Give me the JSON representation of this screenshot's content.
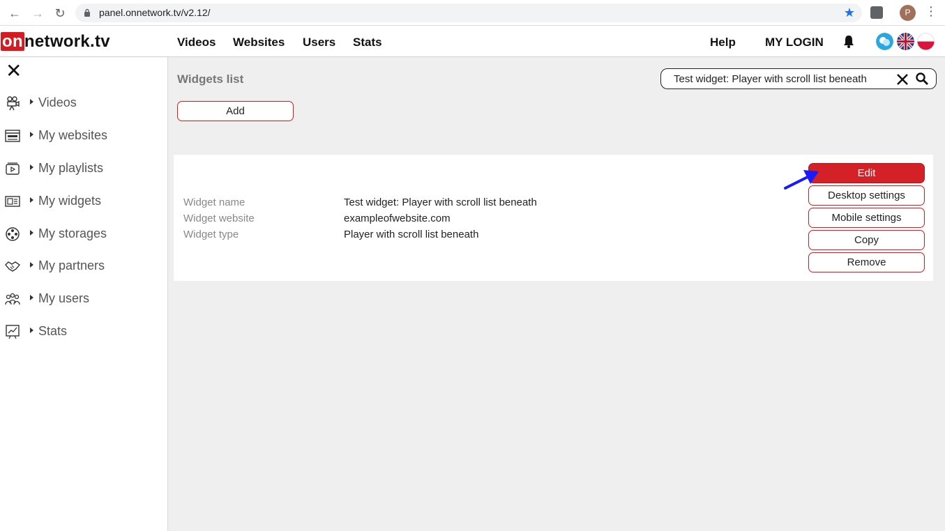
{
  "browser": {
    "url": "panel.onnetwork.tv/v2.12/",
    "avatar_letter": "P"
  },
  "header": {
    "logo_on": "on",
    "logo_rest": "network.tv",
    "nav": [
      "Videos",
      "Websites",
      "Users",
      "Stats"
    ],
    "help": "Help",
    "login": "MY LOGIN"
  },
  "sidebar": {
    "items": [
      {
        "label": "Videos",
        "icon": "camera-icon"
      },
      {
        "label": "My websites",
        "icon": "website-icon"
      },
      {
        "label": "My playlists",
        "icon": "playlist-icon"
      },
      {
        "label": "My widgets",
        "icon": "widget-icon"
      },
      {
        "label": "My storages",
        "icon": "film-reel-icon"
      },
      {
        "label": "My partners",
        "icon": "handshake-icon"
      },
      {
        "label": "My users",
        "icon": "users-icon"
      },
      {
        "label": "Stats",
        "icon": "chart-icon"
      }
    ]
  },
  "main": {
    "title": "Widgets list",
    "add_label": "Add",
    "search_value": "Test widget:  Player with scroll list beneath",
    "widget": {
      "name_label": "Widget name",
      "name_value": "Test widget: Player with scroll list beneath",
      "website_label": "Widget website",
      "website_value": "exampleofwebsite.com",
      "type_label": "Widget type",
      "type_value": "Player with scroll list beneath"
    },
    "actions": {
      "edit": "Edit",
      "desktop": "Desktop settings",
      "mobile": "Mobile settings",
      "copy": "Copy",
      "remove": "Remove"
    }
  },
  "colors": {
    "brand_red": "#d71920",
    "annotation_arrow": "#1a1aff"
  }
}
